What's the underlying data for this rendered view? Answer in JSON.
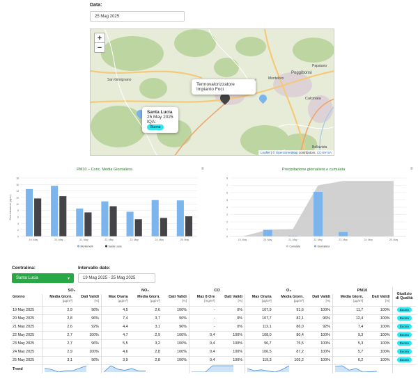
{
  "date_label": "Data:",
  "date_value": "25 Mag 2025",
  "map": {
    "zoom_in": "+",
    "zoom_out": "−",
    "popup_plant": "Termovalorizzatore Impianto Foci",
    "popup_station_name": "Santa Lucia",
    "popup_station_date": "25 May 2025",
    "popup_iqa_label": "IQA:",
    "popup_iqa_value": "Buona",
    "close": "×",
    "places": [
      "Poggibonsi",
      "Papaiano",
      "Calcinaia",
      "Bellavista",
      "Monteloro",
      "Ranza",
      "Cerreto",
      "San Gimignano",
      "Foci"
    ],
    "attribution_leaflet": "Leaflet",
    "attribution_osm": "© OpenStreetMap",
    "attribution_contrib": " contributors, ",
    "attribution_cc": "CC-BY-SA"
  },
  "chart1_title": "PM10 – Conc. Media Giornaliera",
  "chart2_title": "Precipitazione giornaliera e cumulata",
  "chart_data": [
    {
      "type": "bar",
      "title": "PM10 – Conc. Media Giornaliera",
      "categories": [
        "19. May",
        "20. May",
        "21. May",
        "22. May",
        "23. May",
        "24. May",
        "25. May"
      ],
      "series": [
        {
          "name": "Montemorli",
          "color": "#7cb5ec",
          "values": [
            14.6,
            15.6,
            8.6,
            10.8,
            7.6,
            11.2,
            11.1
          ]
        },
        {
          "name": "Santa Lucia",
          "color": "#434348",
          "values": [
            11.7,
            12.4,
            7.4,
            9.3,
            5.3,
            5.7,
            6.2
          ]
        }
      ],
      "ylim": [
        0,
        18
      ],
      "yticks": [
        0,
        2,
        4,
        6,
        8,
        10,
        12,
        14,
        16,
        18
      ],
      "ylabel": "Concentrazione (µg/m³)",
      "legend": "bottom"
    },
    {
      "type": "bar+area",
      "title": "Precipitazione giornaliera e cumulata",
      "categories": [
        "19. May",
        "20. May",
        "21. May",
        "22. May",
        "23. May",
        "24. May",
        "25. May"
      ],
      "series": [
        {
          "name": "Cumulata",
          "type": "area",
          "color": "#cccccc",
          "values": [
            0,
            0.9,
            1.0,
            7.0,
            7.6,
            7.6,
            7.6
          ]
        },
        {
          "name": "Giornaliera",
          "type": "bar",
          "color": "#7cb5ec",
          "values": [
            0,
            0.9,
            0.1,
            6.1,
            0.6,
            0,
            0
          ]
        }
      ],
      "ylim": [
        0,
        8
      ],
      "yticks": [
        0,
        1,
        2,
        3,
        4,
        5,
        6,
        7,
        8
      ],
      "legend": "bottom"
    }
  ],
  "controls": {
    "station_label": "Centralina:",
    "station_value": "Santa Lucia",
    "interval_label": "Intervallo date:",
    "interval_value": "19 Mag 2025 - 25 Mag 2025"
  },
  "table": {
    "group_headers": [
      "SO₂",
      "NO₂",
      "CO",
      "O₃",
      "PM10",
      "Giudizio di Qualità"
    ],
    "day_header": "Giorno",
    "col_headers": [
      {
        "t": "Media Giorn.",
        "u": "[µg/m³]"
      },
      {
        "t": "Dati Validi",
        "u": "[%]"
      },
      {
        "t": "Max Oraria",
        "u": "[µg/m³]"
      },
      {
        "t": "Media Giorn.",
        "u": "[µg/m³]"
      },
      {
        "t": "Dati Validi",
        "u": "[%]"
      },
      {
        "t": "Max 8 Ore",
        "u": "[mg/m³]"
      },
      {
        "t": "Dati Validi",
        "u": "[%]"
      },
      {
        "t": "Max Oraria",
        "u": "[µg/m³]"
      },
      {
        "t": "Media Giorn.",
        "u": "[µg/m³]"
      },
      {
        "t": "Dati Validi",
        "u": "[%]"
      },
      {
        "t": "Media Giorn.",
        "u": "[µg/m³]"
      },
      {
        "t": "Dati Validi",
        "u": "[%]"
      }
    ],
    "rows": [
      [
        "19 May 2025",
        "2,9",
        "96%",
        "4,5",
        "2,6",
        "100%",
        "-",
        "0%",
        "107,9",
        "91,6",
        "100%",
        "11,7",
        "100%",
        "Buona"
      ],
      [
        "20 May 2025",
        "2,8",
        "96%",
        "7,4",
        "3,7",
        "96%",
        "-",
        "0%",
        "107,7",
        "82,1",
        "96%",
        "12,4",
        "100%",
        "Buona"
      ],
      [
        "21 May 2025",
        "2,6",
        "92%",
        "4,4",
        "3,1",
        "96%",
        "-",
        "0%",
        "112,1",
        "86,0",
        "92%",
        "7,4",
        "100%",
        "Buona"
      ],
      [
        "22 May 2025",
        "2,7",
        "100%",
        "4,7",
        "2,9",
        "100%",
        "0,4",
        "100%",
        "108,0",
        "80,4",
        "100%",
        "9,3",
        "100%",
        "Buona"
      ],
      [
        "23 May 2025",
        "2,7",
        "96%",
        "5,5",
        "3,2",
        "100%",
        "0,4",
        "100%",
        "96,7",
        "75,5",
        "100%",
        "5,3",
        "100%",
        "Buona"
      ],
      [
        "24 May 2025",
        "2,9",
        "100%",
        "4,6",
        "2,8",
        "100%",
        "0,4",
        "100%",
        "106,5",
        "87,2",
        "100%",
        "5,7",
        "100%",
        "Buona"
      ],
      [
        "25 May 2025",
        "3,1",
        "96%",
        "3,9",
        "2,8",
        "100%",
        "0,4",
        "100%",
        "119,3",
        "105,2",
        "100%",
        "6,2",
        "100%",
        "Buona"
      ]
    ],
    "trend_label": "Trend"
  }
}
